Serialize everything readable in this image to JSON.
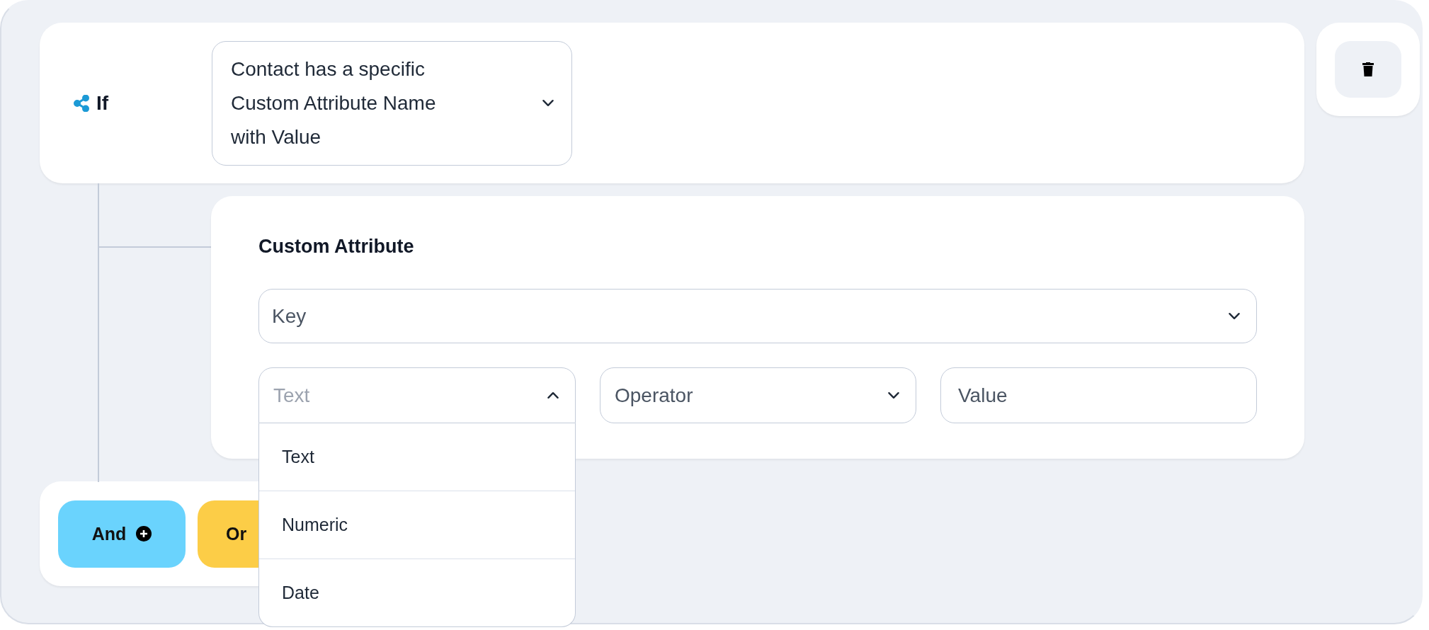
{
  "condition": {
    "label": "If",
    "select": {
      "value": "Contact has a specific Custom Attribute Name with Value",
      "expanded": false
    }
  },
  "custom_attribute": {
    "title": "Custom Attribute",
    "key_select": {
      "placeholder": "Key",
      "expanded": false
    },
    "type_select": {
      "placeholder": "Text",
      "expanded": true,
      "options": [
        {
          "label": "Text",
          "selected": false
        },
        {
          "label": "Numeric",
          "selected": false
        },
        {
          "label": "Date",
          "selected": false
        }
      ]
    },
    "operator_select": {
      "placeholder": "Operator",
      "expanded": false
    },
    "value_field": {
      "placeholder": "Value"
    }
  },
  "logic_buttons": [
    {
      "label": "And",
      "color": "#6ad3fd",
      "kind": "add"
    },
    {
      "label": "Or",
      "color": "#fccd47",
      "kind": "plain"
    }
  ]
}
